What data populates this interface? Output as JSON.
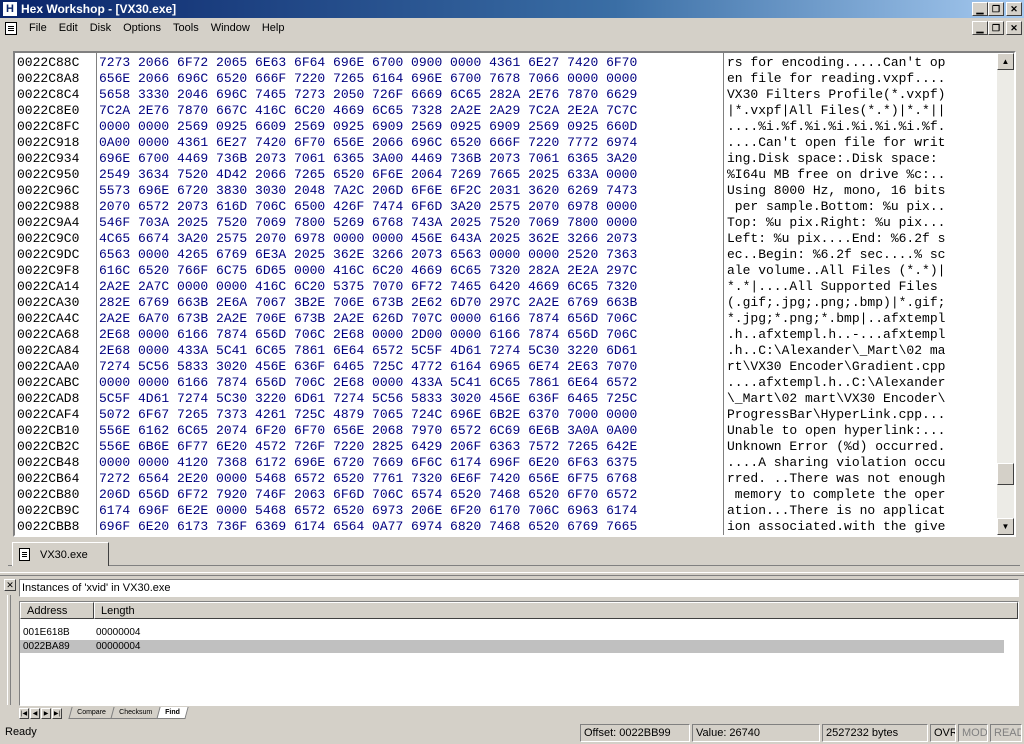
{
  "window": {
    "title": "Hex Workshop - [VX30.exe]"
  },
  "menu": [
    "File",
    "Edit",
    "Disk",
    "Options",
    "Tools",
    "Window",
    "Help"
  ],
  "hex_rows": [
    {
      "addr": "0022C88C",
      "hex": "7273 2066 6F72 2065 6E63 6F64 696E 6700 0900 0000 4361 6E27 7420 6F70",
      "ascii": "rs for encoding.....Can't op"
    },
    {
      "addr": "0022C8A8",
      "hex": "656E 2066 696C 6520 666F 7220 7265 6164 696E 6700 7678 7066 0000 0000",
      "ascii": "en file for reading.vxpf...."
    },
    {
      "addr": "0022C8C4",
      "hex": "5658 3330 2046 696C 7465 7273 2050 726F 6669 6C65 282A 2E76 7870 6629",
      "ascii": "VX30 Filters Profile(*.vxpf)"
    },
    {
      "addr": "0022C8E0",
      "hex": "7C2A 2E76 7870 667C 416C 6C20 4669 6C65 7328 2A2E 2A29 7C2A 2E2A 7C7C",
      "ascii": "|*.vxpf|All Files(*.*)|*.*||"
    },
    {
      "addr": "0022C8FC",
      "hex": "0000 0000 2569 0925 6609 2569 0925 6909 2569 0925 6909 2569 0925 660D",
      "ascii": "....%i.%f.%i.%i.%i.%i.%i.%f."
    },
    {
      "addr": "0022C918",
      "hex": "0A00 0000 4361 6E27 7420 6F70 656E 2066 696C 6520 666F 7220 7772 6974",
      "ascii": "....Can't open file for writ"
    },
    {
      "addr": "0022C934",
      "hex": "696E 6700 4469 736B 2073 7061 6365 3A00 4469 736B 2073 7061 6365 3A20",
      "ascii": "ing.Disk space:.Disk space: "
    },
    {
      "addr": "0022C950",
      "hex": "2549 3634 7520 4D42 2066 7265 6520 6F6E 2064 7269 7665 2025 633A 0000",
      "ascii": "%I64u MB free on drive %c:.."
    },
    {
      "addr": "0022C96C",
      "hex": "5573 696E 6720 3830 3030 2048 7A2C 206D 6F6E 6F2C 2031 3620 6269 7473",
      "ascii": "Using 8000 Hz, mono, 16 bits"
    },
    {
      "addr": "0022C988",
      "hex": "2070 6572 2073 616D 706C 6500 426F 7474 6F6D 3A20 2575 2070 6978 0000",
      "ascii": " per sample.Bottom: %u pix.."
    },
    {
      "addr": "0022C9A4",
      "hex": "546F 703A 2025 7520 7069 7800 5269 6768 743A 2025 7520 7069 7800 0000",
      "ascii": "Top: %u pix.Right: %u pix..."
    },
    {
      "addr": "0022C9C0",
      "hex": "4C65 6674 3A20 2575 2070 6978 0000 0000 456E 643A 2025 362E 3266 2073",
      "ascii": "Left: %u pix....End: %6.2f s"
    },
    {
      "addr": "0022C9DC",
      "hex": "6563 0000 4265 6769 6E3A 2025 362E 3266 2073 6563 0000 0000 2520 7363",
      "ascii": "ec..Begin: %6.2f sec....% sc"
    },
    {
      "addr": "0022C9F8",
      "hex": "616C 6520 766F 6C75 6D65 0000 416C 6C20 4669 6C65 7320 282A 2E2A 297C",
      "ascii": "ale volume..All Files (*.*)|"
    },
    {
      "addr": "0022CA14",
      "hex": "2A2E 2A7C 0000 0000 416C 6C20 5375 7070 6F72 7465 6420 4669 6C65 7320",
      "ascii": "*.*|....All Supported Files "
    },
    {
      "addr": "0022CA30",
      "hex": "282E 6769 663B 2E6A 7067 3B2E 706E 673B 2E62 6D70 297C 2A2E 6769 663B",
      "ascii": "(.gif;.jpg;.png;.bmp)|*.gif;"
    },
    {
      "addr": "0022CA4C",
      "hex": "2A2E 6A70 673B 2A2E 706E 673B 2A2E 626D 707C 0000 6166 7874 656D 706C",
      "ascii": "*.jpg;*.png;*.bmp|..afxtempl"
    },
    {
      "addr": "0022CA68",
      "hex": "2E68 0000 6166 7874 656D 706C 2E68 0000 2D00 0000 6166 7874 656D 706C",
      "ascii": ".h..afxtempl.h..-...afxtempl"
    },
    {
      "addr": "0022CA84",
      "hex": "2E68 0000 433A 5C41 6C65 7861 6E64 6572 5C5F 4D61 7274 5C30 3220 6D61",
      "ascii": ".h..C:\\Alexander\\_Mart\\02 ma"
    },
    {
      "addr": "0022CAA0",
      "hex": "7274 5C56 5833 3020 456E 636F 6465 725C 4772 6164 6965 6E74 2E63 7070",
      "ascii": "rt\\VX30 Encoder\\Gradient.cpp"
    },
    {
      "addr": "0022CABC",
      "hex": "0000 0000 6166 7874 656D 706C 2E68 0000 433A 5C41 6C65 7861 6E64 6572",
      "ascii": "....afxtempl.h..C:\\Alexander"
    },
    {
      "addr": "0022CAD8",
      "hex": "5C5F 4D61 7274 5C30 3220 6D61 7274 5C56 5833 3020 456E 636F 6465 725C",
      "ascii": "\\_Mart\\02 mart\\VX30 Encoder\\"
    },
    {
      "addr": "0022CAF4",
      "hex": "5072 6F67 7265 7373 4261 725C 4879 7065 724C 696E 6B2E 6370 7000 0000",
      "ascii": "ProgressBar\\HyperLink.cpp..."
    },
    {
      "addr": "0022CB10",
      "hex": "556E 6162 6C65 2074 6F20 6F70 656E 2068 7970 6572 6C69 6E6B 3A0A 0A00",
      "ascii": "Unable to open hyperlink:..."
    },
    {
      "addr": "0022CB2C",
      "hex": "556E 6B6E 6F77 6E20 4572 726F 7220 2825 6429 206F 6363 7572 7265 642E",
      "ascii": "Unknown Error (%d) occurred."
    },
    {
      "addr": "0022CB48",
      "hex": "0000 0000 4120 7368 6172 696E 6720 7669 6F6C 6174 696F 6E20 6F63 6375",
      "ascii": "....A sharing violation occu"
    },
    {
      "addr": "0022CB64",
      "hex": "7272 6564 2E20 0000 5468 6572 6520 7761 7320 6E6F 7420 656E 6F75 6768",
      "ascii": "rred. ..There was not enough"
    },
    {
      "addr": "0022CB80",
      "hex": "206D 656D 6F72 7920 746F 2063 6F6D 706C 6574 6520 7468 6520 6F70 6572",
      "ascii": " memory to complete the oper"
    },
    {
      "addr": "0022CB9C",
      "hex": "6174 696F 6E2E 0000 5468 6572 6520 6973 206E 6F20 6170 706C 6963 6174",
      "ascii": "ation...There is no applicat"
    },
    {
      "addr": "0022CBB8",
      "hex": "696F 6E20 6173 736F 6369 6174 6564 0A77 6974 6820 7468 6520 6769 7665",
      "ascii": "ion associated.with the give"
    }
  ],
  "doc_tab": "VX30.exe",
  "find": {
    "title": "Instances of 'xvid' in VX30.exe",
    "columns": [
      "Address",
      "Length"
    ],
    "rows": [
      {
        "address": "001E618B",
        "length": "00000004",
        "selected": false
      },
      {
        "address": "0022BA89",
        "length": "00000004",
        "selected": true
      }
    ]
  },
  "panel_tabs": [
    "Compare",
    "Checksum",
    "Find"
  ],
  "status": {
    "message": "Ready",
    "offset": "Offset: 0022BB99",
    "value": "Value: 26740",
    "size": "2527232 bytes",
    "ovr": "OVR",
    "mod": "MOD",
    "read": "READ"
  }
}
